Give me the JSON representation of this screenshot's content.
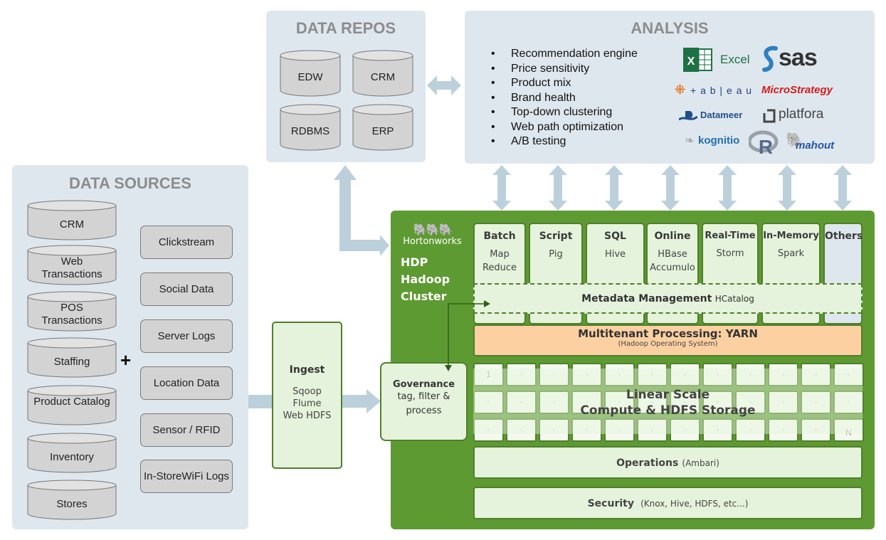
{
  "data_sources": {
    "title": "DATA SOURCES",
    "databases": [
      "CRM",
      "Web Transactions",
      "POS Transactions",
      "Staffing",
      "Product Catalog",
      "Inventory",
      "Stores"
    ],
    "streams": [
      "Clickstream",
      "Social Data",
      "Server Logs",
      "Location Data",
      "Sensor / RFID",
      "In-Store WiFi Logs"
    ],
    "plus": "+"
  },
  "data_repos": {
    "title": "DATA REPOS",
    "databases": [
      "EDW",
      "CRM",
      "RDBMS",
      "ERP"
    ]
  },
  "analysis": {
    "title": "ANALYSIS",
    "use_cases": [
      "Recommendation engine",
      "Price sensitivity",
      "Product mix",
      "Brand health",
      "Top-down clustering",
      "Web path optimization",
      "A/B testing"
    ],
    "tools": {
      "excel": "Excel",
      "sas": "sas",
      "tableau": "+ a b | e a u",
      "microstrategy": "MicroStrategy",
      "datameer": "Datameer",
      "platfora": "platfora",
      "kognitio": "kognitio",
      "r": "R",
      "mahout": "mahout"
    }
  },
  "ingest": {
    "title": "Ingest",
    "tools": [
      "Sqoop",
      "Flume",
      "Web HDFS"
    ]
  },
  "hdp": {
    "brand": "Hortonworks",
    "title_lines": [
      "HDP",
      "Hadoop",
      "Cluster"
    ],
    "governance": {
      "title": "Governance",
      "desc": [
        "tag, filter &",
        "process"
      ]
    },
    "engines": [
      {
        "title": "Batch",
        "sub": [
          "Map",
          "Reduce"
        ]
      },
      {
        "title": "Script",
        "sub": [
          "Pig"
        ]
      },
      {
        "title": "SQL",
        "sub": [
          "Hive"
        ]
      },
      {
        "title": "Online",
        "sub": [
          "HBase",
          "Accumulo"
        ]
      },
      {
        "title": "Real-Time",
        "sub": [
          "Storm"
        ]
      },
      {
        "title": "In-Memory",
        "sub": [
          "Spark"
        ]
      },
      {
        "title": "Others",
        "sub": []
      }
    ],
    "metadata": {
      "title": "Metadata Management",
      "tool": "HCatalog"
    },
    "yarn": {
      "title": "Multitenant Processing: YARN",
      "sub": "(Hadoop Operating System)"
    },
    "storage": {
      "line1": "Linear Scale",
      "line2": "Compute & HDFS Storage",
      "first_node": "1",
      "last_node": "N",
      "node_dot": "◦"
    },
    "operations": {
      "title": "Operations",
      "tool": "(Ambari)"
    },
    "security": {
      "title": "Security",
      "tool": "(Knox, Hive, HDFS, etc...)"
    }
  },
  "colors": {
    "panel_bg": "#dfe7ee",
    "arrow": "#bcd0dc",
    "hdp_green": "#5e9a32",
    "light_green": "#e6f3dc",
    "yarn_orange": "#fdd0a2",
    "others_blue": "#dfe7ee"
  }
}
